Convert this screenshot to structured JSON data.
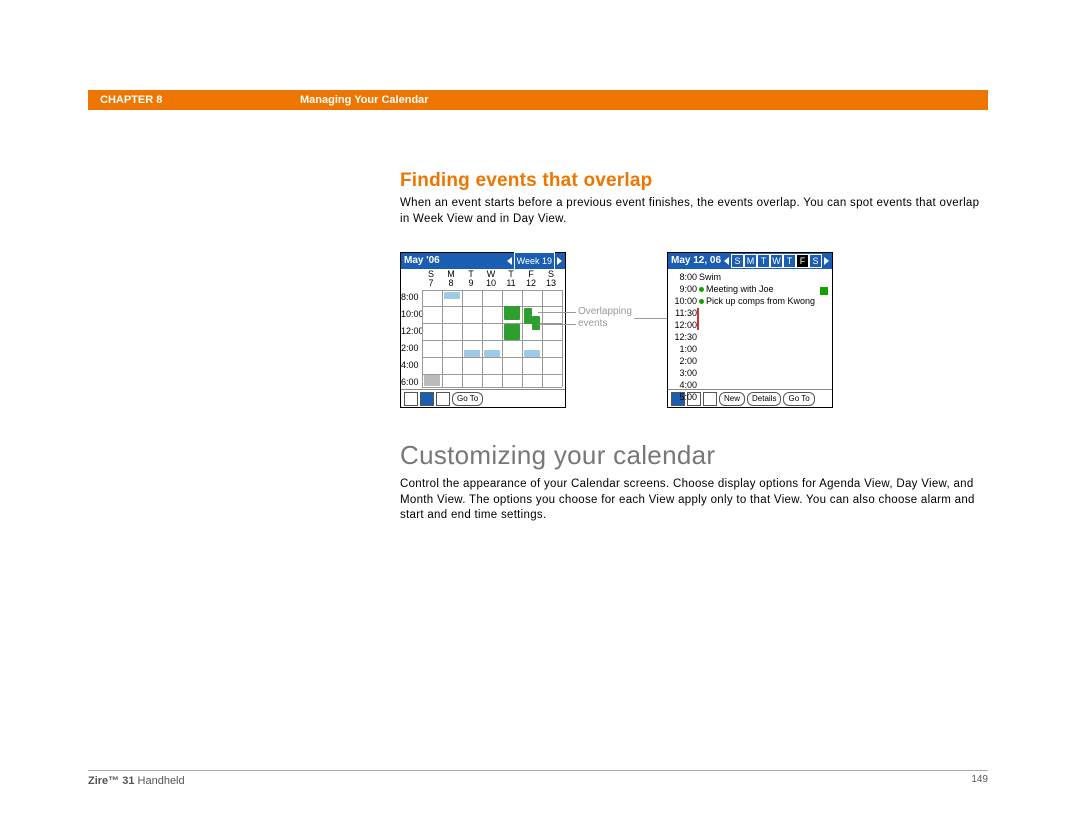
{
  "header": {
    "chapter_label": "CHAPTER 8",
    "section_label": "Managing Your Calendar"
  },
  "section1": {
    "heading": "Finding events that overlap",
    "body": "When an event starts before a previous event finishes, the events overlap. You can spot events that overlap in Week View and in Day View."
  },
  "callout": {
    "line1": "Overlapping",
    "line2": "events"
  },
  "week_view": {
    "title": "May '06",
    "week_label": "Week 19",
    "day_labels": [
      "S",
      "M",
      "T",
      "W",
      "T",
      "F",
      "S"
    ],
    "day_nums": [
      "7",
      "8",
      "9",
      "10",
      "11",
      "12",
      "13"
    ],
    "times": [
      "8:00",
      "10:00",
      "12:00",
      "2:00",
      "4:00",
      "6:00"
    ],
    "footer_btn": "Go To"
  },
  "day_view": {
    "title": "May 12, 06",
    "day_picker": [
      "S",
      "M",
      "T",
      "W",
      "T",
      "F",
      "S"
    ],
    "selected_day_index": 5,
    "events": [
      {
        "time": "8:00",
        "text": "Swim"
      },
      {
        "time": "9:00",
        "text": ""
      },
      {
        "time": "10:00",
        "text": "Meeting with Joe",
        "dot": "green"
      },
      {
        "time": "11:30",
        "text": "Pick up comps from Kwong",
        "dot": "green"
      },
      {
        "time": "12:00",
        "text": ""
      },
      {
        "time": "12:30",
        "text": ""
      },
      {
        "time": "1:00",
        "text": ""
      },
      {
        "time": "2:00",
        "text": ""
      },
      {
        "time": "3:00",
        "text": ""
      },
      {
        "time": "4:00",
        "text": ""
      },
      {
        "time": "5:00",
        "text": ""
      }
    ],
    "footer_btns": [
      "New",
      "Details",
      "Go To"
    ]
  },
  "section2": {
    "heading": "Customizing your calendar",
    "body": "Control the appearance of your Calendar screens. Choose display options for Agenda View, Day View, and Month View. The options you choose for each View apply only to that View. You can also choose alarm and start and end time settings."
  },
  "footer": {
    "product_bold": "Zire™ 31",
    "product_light": " Handheld",
    "page_num": "149"
  }
}
